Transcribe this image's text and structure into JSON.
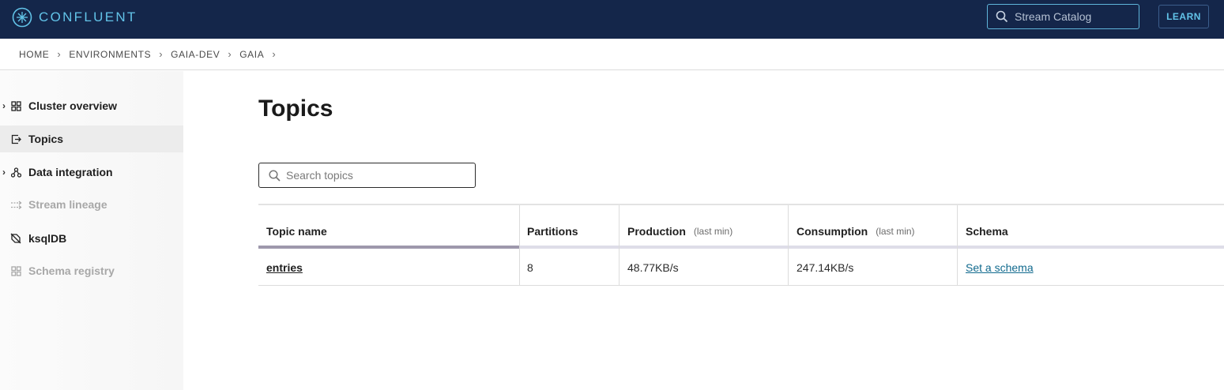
{
  "header": {
    "brand": "CONFLUENT",
    "catalog_placeholder": "Stream Catalog",
    "learn_label": "LEARN"
  },
  "breadcrumb": [
    "HOME",
    "ENVIRONMENTS",
    "GAIA-DEV",
    "GAIA"
  ],
  "breadcrumb_separator": "›",
  "sidebar": {
    "items": [
      {
        "label": "Cluster overview",
        "icon": "grid-icon",
        "expandable": true,
        "state": "normal"
      },
      {
        "label": "Topics",
        "icon": "topics-icon",
        "expandable": false,
        "state": "active"
      },
      {
        "label": "Data integration",
        "icon": "integration-icon",
        "expandable": true,
        "state": "normal"
      },
      {
        "label": "Stream lineage",
        "icon": "lineage-icon",
        "expandable": false,
        "state": "disabled"
      },
      {
        "label": "ksqlDB",
        "icon": "ksqldb-icon",
        "expandable": false,
        "state": "normal"
      },
      {
        "label": "Schema registry",
        "icon": "schema-registry-icon",
        "expandable": false,
        "state": "disabled"
      }
    ]
  },
  "main": {
    "title": "Topics",
    "search_placeholder": "Search topics",
    "table": {
      "columns": [
        {
          "label": "Topic name",
          "sub": ""
        },
        {
          "label": "Partitions",
          "sub": ""
        },
        {
          "label": "Production",
          "sub": "(last min)"
        },
        {
          "label": "Consumption",
          "sub": "(last min)"
        },
        {
          "label": "Schema",
          "sub": ""
        }
      ],
      "rows": [
        {
          "topic": "entries",
          "partitions": "8",
          "production": "48.77KB/s",
          "consumption": "247.14KB/s",
          "schema": "Set a schema"
        }
      ]
    }
  },
  "colors": {
    "topbar": "#14264a",
    "brand_accent": "#62c3e8",
    "link": "#116a8e"
  }
}
